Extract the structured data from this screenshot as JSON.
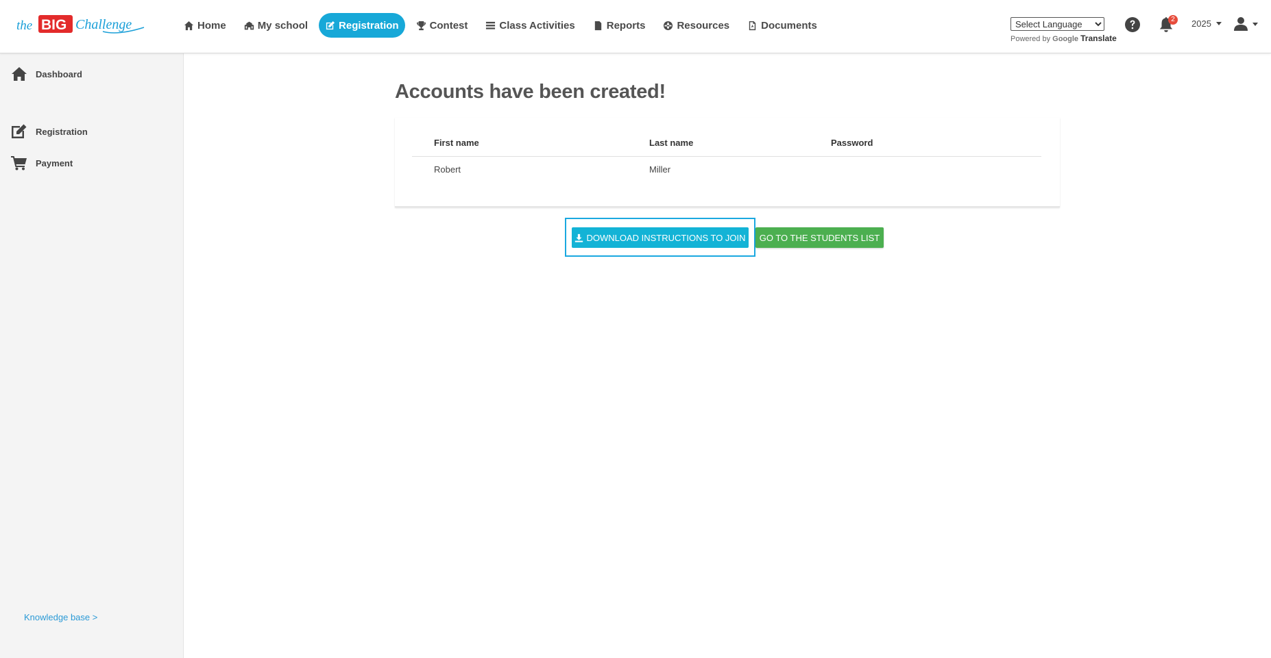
{
  "brand": {
    "logo_prefix": "the",
    "logo_big": "BIG",
    "logo_suffix": "Challenge",
    "red": "#e32b2b",
    "blue": "#1a9fd8"
  },
  "nav": [
    {
      "label": "Home",
      "icon": "home-icon"
    },
    {
      "label": "My school",
      "icon": "school-icon"
    },
    {
      "label": "Registration",
      "icon": "edit-icon",
      "active": true
    },
    {
      "label": "Contest",
      "icon": "trophy-icon"
    },
    {
      "label": "Class Activities",
      "icon": "list-icon"
    },
    {
      "label": "Reports",
      "icon": "document-icon"
    },
    {
      "label": "Resources",
      "icon": "globe-icon"
    },
    {
      "label": "Documents",
      "icon": "pdf-icon"
    }
  ],
  "translate": {
    "select_label": "Select Language",
    "powered_by": "Powered by",
    "google": "Google",
    "translate": "Translate"
  },
  "header": {
    "notifications_count": "2",
    "year": "2025"
  },
  "sidebar": {
    "items": [
      {
        "label": "Dashboard",
        "icon": "home-icon"
      },
      {
        "label": "Registration",
        "icon": "edit-icon"
      },
      {
        "label": "Payment",
        "icon": "cart-icon"
      }
    ],
    "knowledge_base": "Knowledge base >"
  },
  "main": {
    "title": "Accounts have been created!",
    "table": {
      "headers": [
        "First name",
        "Last name",
        "Password"
      ],
      "rows": [
        [
          "Robert",
          "Miller",
          ""
        ]
      ]
    },
    "download_button": "DOWNLOAD INSTRUCTIONS TO JOIN",
    "students_button": "GO TO THE STUDENTS LIST"
  },
  "colors": {
    "accent": "#17a8d8",
    "success": "#4caf50",
    "badge": "#e74c3c"
  }
}
